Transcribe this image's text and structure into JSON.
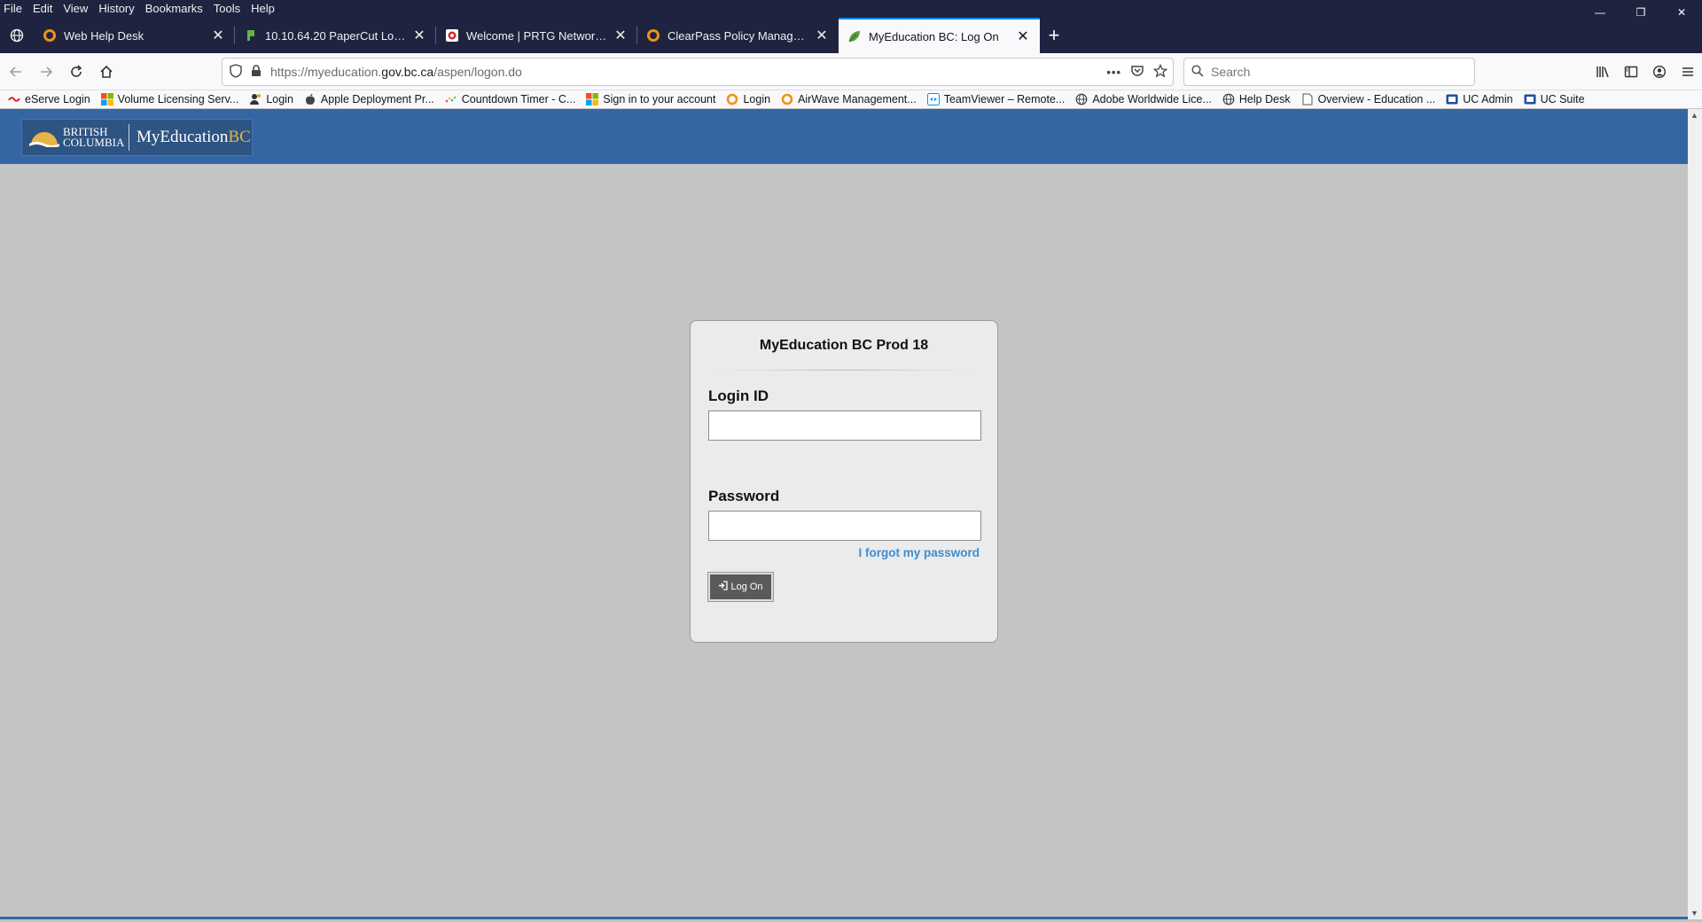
{
  "menu": [
    "File",
    "Edit",
    "View",
    "History",
    "Bookmarks",
    "Tools",
    "Help"
  ],
  "tabs": [
    {
      "label": "Web Help Desk",
      "icon": "orange-ring-icon",
      "active": false
    },
    {
      "label": "10.10.64.20 PaperCut Login",
      "icon": "papercut-icon",
      "active": false
    },
    {
      "label": "Welcome | PRTG Network Monitor",
      "icon": "prtg-icon",
      "active": false
    },
    {
      "label": "ClearPass Policy Manager - Aruba",
      "icon": "orange-ring-icon",
      "active": false
    },
    {
      "label": "MyEducation BC: Log On",
      "icon": "leaf-icon",
      "active": true
    }
  ],
  "nav": {
    "url_prefix": "https://myeducation.",
    "url_domain": "gov.bc.ca",
    "url_suffix": "/aspen/logon.do",
    "search_placeholder": "Search"
  },
  "bookmarks": [
    {
      "label": "eServe Login",
      "icon": "eserve-icon"
    },
    {
      "label": "Volume Licensing Serv...",
      "icon": "windows-icon"
    },
    {
      "label": "Login",
      "icon": "person-icon"
    },
    {
      "label": "Apple Deployment Pr...",
      "icon": "apple-icon"
    },
    {
      "label": "Countdown Timer - C...",
      "icon": "dots-icon"
    },
    {
      "label": "Sign in to your account",
      "icon": "windows-icon"
    },
    {
      "label": "Login",
      "icon": "orange-ring-icon"
    },
    {
      "label": "AirWave Management...",
      "icon": "orange-ring-icon"
    },
    {
      "label": "TeamViewer – Remote...",
      "icon": "teamviewer-icon"
    },
    {
      "label": "Adobe Worldwide Lice...",
      "icon": "globe-icon"
    },
    {
      "label": "Help Desk",
      "icon": "globe-icon"
    },
    {
      "label": "Overview - Education ...",
      "icon": "page-icon"
    },
    {
      "label": "UC Admin",
      "icon": "uc-icon"
    },
    {
      "label": "UC Suite",
      "icon": "uc-icon"
    }
  ],
  "header": {
    "logo_line1": "BRITISH",
    "logo_line2": "COLUMBIA",
    "brand_main": "MyEducation",
    "brand_accent": "BC"
  },
  "login": {
    "title": "MyEducation BC Prod 18",
    "login_id_label": "Login ID",
    "login_id_value": "",
    "password_label": "Password",
    "password_value": "",
    "forgot_link": "I forgot my password",
    "logon_button": "Log On"
  },
  "colors": {
    "header_blue": "#3566a4",
    "page_gray": "#c4c4c4",
    "link_blue": "#3c8ed0",
    "brand_gold": "#e2b34a"
  }
}
